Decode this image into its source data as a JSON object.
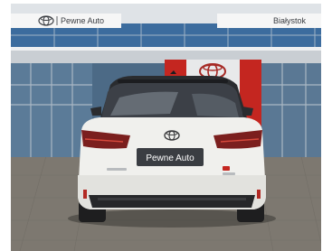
{
  "photo": {
    "subject": "Rear view of white Toyota Corolla Touring Sports at dealership",
    "colors": {
      "sky_glass": "#3f6fa0",
      "facade_white": "#e9ecef",
      "toyota_red": "#c8261f",
      "car_body": "#f1f1ef",
      "pavement": "#7f7a73"
    }
  },
  "signs": {
    "left_sign_text": "Pewne Auto",
    "right_sign_text": "Białystok"
  },
  "car": {
    "license_plate_text": "Pewne Auto"
  }
}
